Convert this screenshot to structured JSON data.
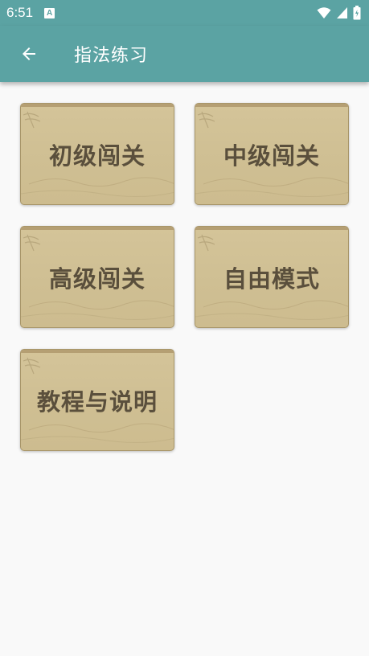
{
  "status": {
    "time": "6:51",
    "notification_glyph": "A"
  },
  "app_bar": {
    "title": "指法练习",
    "back_icon": "arrow-left-icon"
  },
  "menu": {
    "items": [
      {
        "label": "初级闯关"
      },
      {
        "label": "中级闯关"
      },
      {
        "label": "高级闯关"
      },
      {
        "label": "自由模式"
      },
      {
        "label": "教程与说明"
      }
    ]
  },
  "colors": {
    "accent": "#5ba3a3",
    "card_bg": "#d1c195",
    "card_text": "#5a4f3c"
  }
}
